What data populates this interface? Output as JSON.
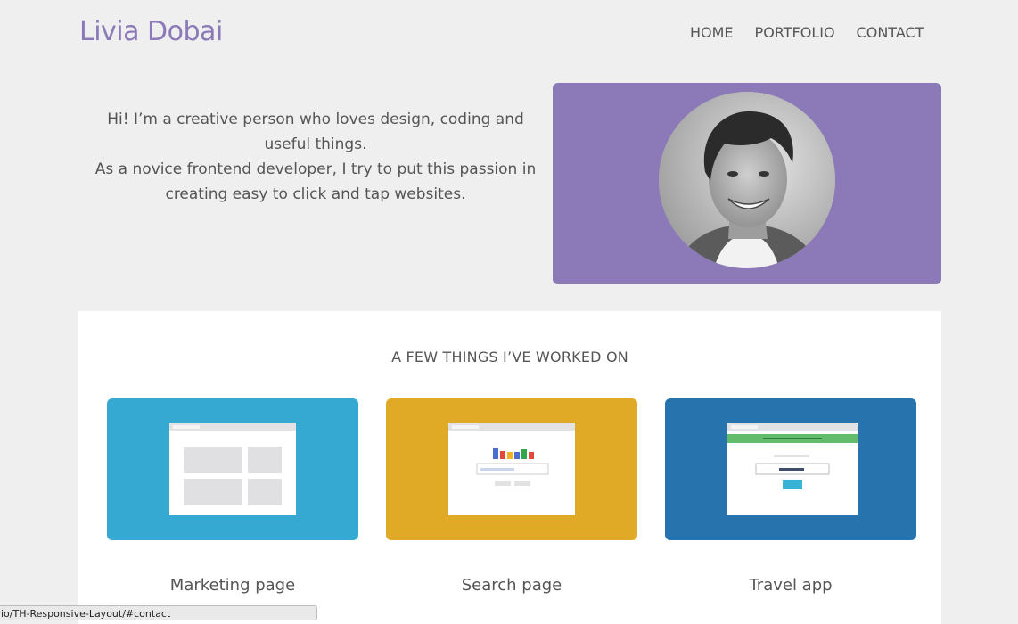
{
  "header": {
    "logo": "Livia Dobai",
    "nav": [
      {
        "label": "HOME"
      },
      {
        "label": "PORTFOLIO"
      },
      {
        "label": "CONTACT"
      }
    ]
  },
  "hero": {
    "paragraph1": "Hi! I’m a creative person who loves design, coding and useful things.",
    "paragraph2": "As a novice frontend developer, I try to put this passion in creating easy to click and tap websites.",
    "accent_color": "#8c7ab8"
  },
  "portfolio": {
    "heading": "A FEW THINGS I’VE WORKED ON",
    "items": [
      {
        "caption": "Marketing page",
        "color": "#36a9d2"
      },
      {
        "caption": "Search page",
        "color": "#e0aa26"
      },
      {
        "caption": "Travel app",
        "color": "#2773ae"
      }
    ]
  },
  "statusbar": {
    "url": "io/TH-Responsive-Layout/#contact"
  }
}
